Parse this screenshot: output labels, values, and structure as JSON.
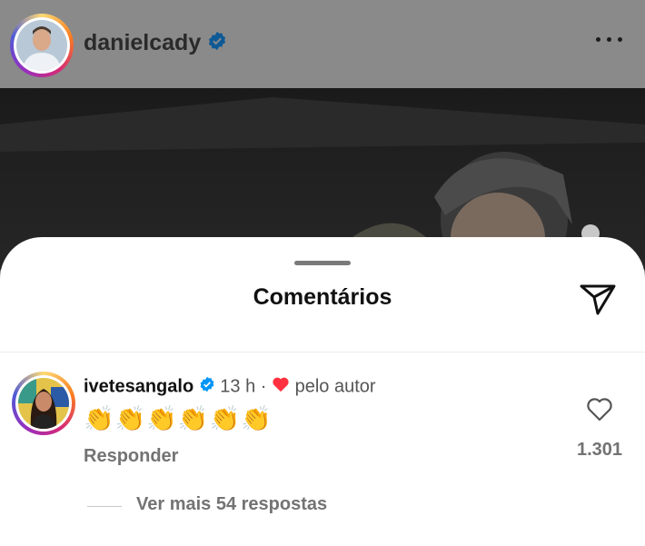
{
  "post": {
    "username": "danielcady",
    "verified": true,
    "more_icon": "more-horizontal-icon"
  },
  "comments_sheet": {
    "title": "Comentários",
    "share_icon": "send-icon"
  },
  "comment": {
    "username": "ivetesangalo",
    "verified": true,
    "time": "13 h",
    "separator": "·",
    "liked_by_author": "pelo autor",
    "text": "👏👏👏👏👏👏",
    "reply_label": "Responder",
    "like_count": "1.301",
    "view_more": "Ver mais 54 respostas"
  },
  "colors": {
    "verified_blue": "#0095f6",
    "heart_red": "#ff3040"
  }
}
